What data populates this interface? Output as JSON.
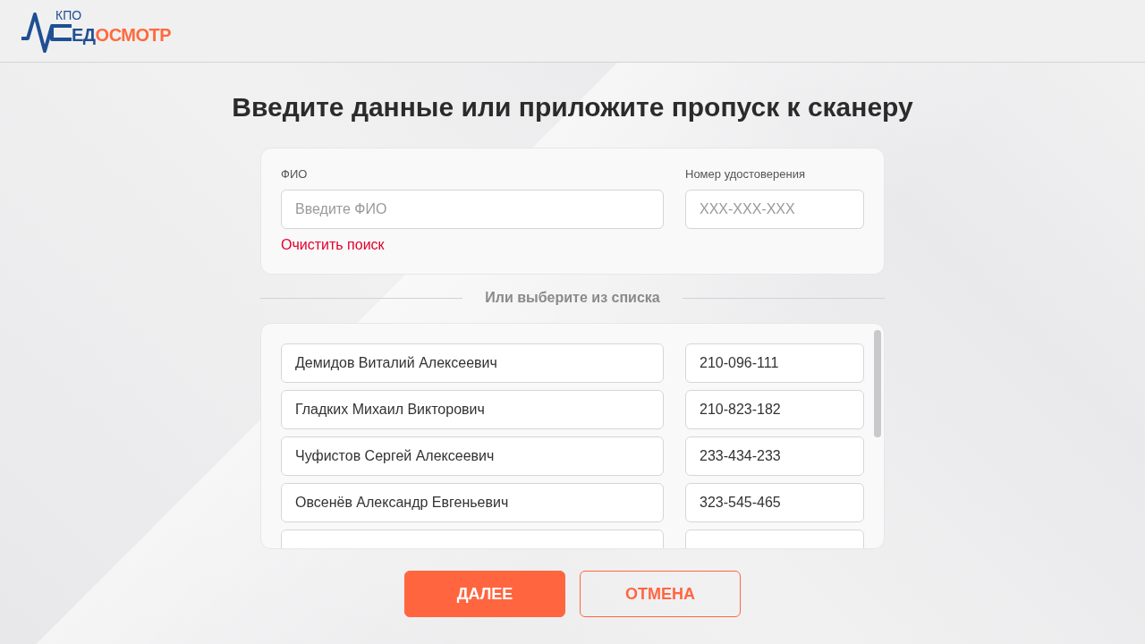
{
  "header": {
    "logo": {
      "caption": "КПО",
      "text_primary": "ЕД",
      "text_accent": "ОСМОТР"
    }
  },
  "title": "Введите данные или приложите пропуск к сканеру",
  "search": {
    "fields": [
      {
        "kind": "name",
        "label": "ФИО",
        "placeholder": "Введите ФИО"
      },
      {
        "kind": "number",
        "label": "Номер удостоверения",
        "placeholder": "XXX-XXX-XXX"
      }
    ],
    "clear_link": "Очистить поиск"
  },
  "divider": "Или выберите из списка",
  "list": {
    "rows": [
      {
        "name": "Демидов Виталий Алексеевич",
        "number": "210-096-111",
        "selected": false
      },
      {
        "name": "Гладких Михаил Викторович",
        "number": "210-823-182",
        "selected": false
      },
      {
        "name": "Чуфистов Сергей Алексеевич",
        "number": "233-434-233",
        "selected": false
      },
      {
        "name": "Овсенёв Александр Евгеньевич",
        "number": "323-545-465",
        "selected": false
      }
    ],
    "cut_row": true
  },
  "buttons": [
    {
      "kind": "primary",
      "label": "ДАЛЕЕ"
    },
    {
      "kind": "outline",
      "label": "ОТМЕНА"
    }
  ]
}
